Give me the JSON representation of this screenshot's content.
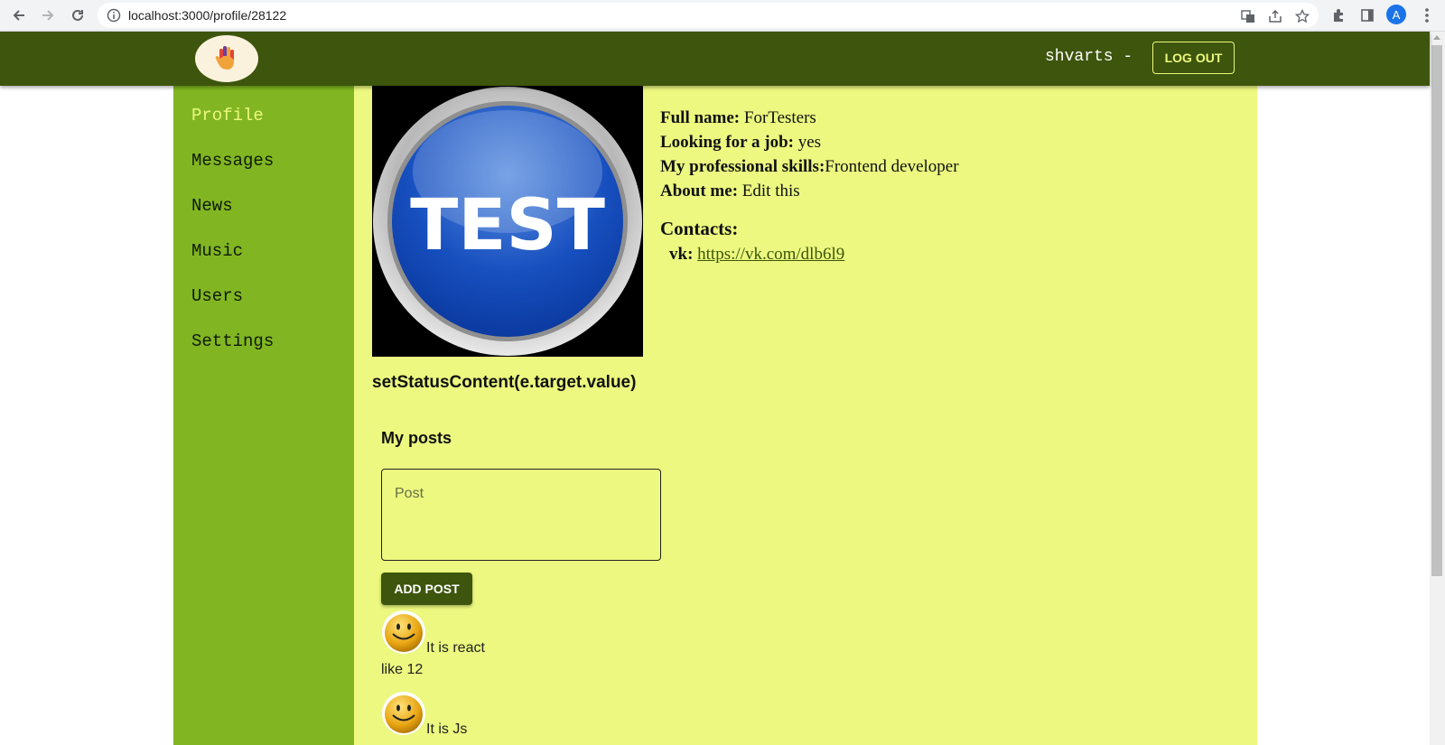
{
  "browser": {
    "url": "localhost:3000/profile/28122",
    "avatar_letter": "A"
  },
  "header": {
    "user_name": "shvarts -",
    "logout_label": "LOG OUT"
  },
  "sidebar": {
    "items": [
      {
        "label": "Profile",
        "active": true
      },
      {
        "label": "Messages",
        "active": false
      },
      {
        "label": "News",
        "active": false
      },
      {
        "label": "Music",
        "active": false
      },
      {
        "label": "Users",
        "active": false
      },
      {
        "label": "Settings",
        "active": false
      }
    ]
  },
  "profile": {
    "photo_text": "TEST",
    "status": "setStatusContent(e.target.value)",
    "full_name_label": "Full name:",
    "full_name": "ForTesters",
    "job_label": "Looking for a job:",
    "job": "yes",
    "skills_label": "My professional skills:",
    "skills": "Frontend developer",
    "about_label": "About me:",
    "about": "Edit this",
    "contacts_title": "Contacts:",
    "contacts": [
      {
        "label": "vk:",
        "value": "https://vk.com/dlb6l9"
      }
    ]
  },
  "posts": {
    "title": "My posts",
    "placeholder": "Post",
    "add_label": "ADD POST",
    "items": [
      {
        "text": "It is react",
        "likes": "like 12"
      },
      {
        "text": "It is Js",
        "likes": ""
      }
    ]
  },
  "colors": {
    "header_bg": "#3d550c",
    "sidebar_bg": "#81b622",
    "content_bg": "#ecf87f",
    "accent": "#ecf87f"
  }
}
